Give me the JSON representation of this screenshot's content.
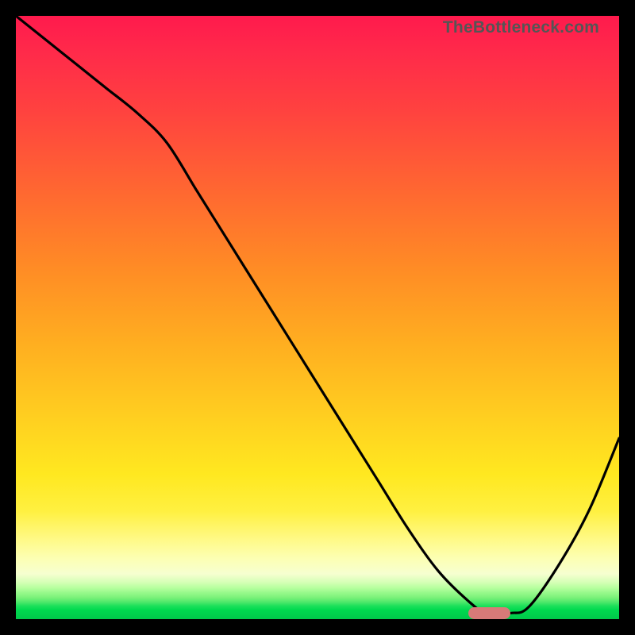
{
  "watermark": "TheBottleneck.com",
  "colors": {
    "frame": "#000000",
    "curve": "#000000",
    "pill": "#d87a78"
  },
  "chart_data": {
    "type": "line",
    "title": "",
    "xlabel": "",
    "ylabel": "",
    "xlim": [
      0,
      100
    ],
    "ylim": [
      0,
      100
    ],
    "x": [
      0,
      5,
      10,
      15,
      20,
      25,
      30,
      35,
      40,
      45,
      50,
      55,
      60,
      65,
      70,
      75,
      78,
      82,
      85,
      90,
      95,
      100
    ],
    "values": [
      100,
      96,
      92,
      88,
      84,
      79,
      71,
      63,
      55,
      47,
      39,
      31,
      23,
      15,
      8,
      3,
      1,
      1,
      2,
      9,
      18,
      30
    ],
    "annotations": [
      {
        "kind": "highlight-band",
        "x_start": 75,
        "x_end": 82,
        "y": 1
      }
    ],
    "background": {
      "gradient_stops": [
        {
          "pos": 0.0,
          "color": "#ff1a4d"
        },
        {
          "pos": 0.3,
          "color": "#ff6a30"
        },
        {
          "pos": 0.55,
          "color": "#ffb020"
        },
        {
          "pos": 0.76,
          "color": "#ffe820"
        },
        {
          "pos": 0.9,
          "color": "#fcffb4"
        },
        {
          "pos": 0.96,
          "color": "#7cf27a"
        },
        {
          "pos": 1.0,
          "color": "#00c84a"
        }
      ]
    }
  }
}
